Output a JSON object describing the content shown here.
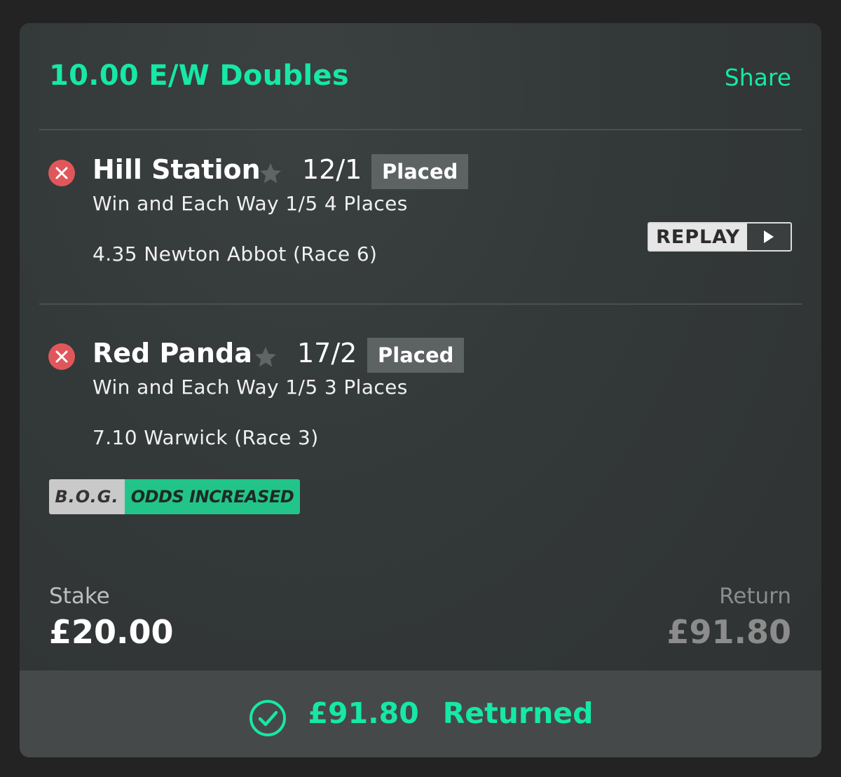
{
  "header": {
    "title": "10.00 E/W Doubles",
    "share_label": "Share"
  },
  "selections": [
    {
      "name": "Hill Station",
      "odds": "12/1",
      "status": "Placed",
      "market": "Win and Each Way 1/5 4 Places",
      "race": "4.35 Newton Abbot (Race 6)",
      "result_icon": "x-circle-icon"
    },
    {
      "name": "Red Panda",
      "odds": "17/2",
      "status": "Placed",
      "market": "Win and Each Way 1/5 3 Places",
      "race": "7.10 Warwick (Race 3)",
      "result_icon": "x-circle-icon"
    }
  ],
  "replay": {
    "label": "REPLAY",
    "icon": "play-icon"
  },
  "bog_badge": {
    "left": "B.O.G.",
    "right": "ODDS INCREASED"
  },
  "summary": {
    "stake_label": "Stake",
    "stake_value": "£20.00",
    "return_label": "Return",
    "return_value": "£91.80"
  },
  "footer": {
    "amount": "£91.80",
    "status": "Returned",
    "icon": "check-circle-icon"
  },
  "colors": {
    "accent": "#16e8a5",
    "loss_red": "#e0575b",
    "badge_gray": "#5d6262",
    "bog_green": "#22c48a"
  }
}
